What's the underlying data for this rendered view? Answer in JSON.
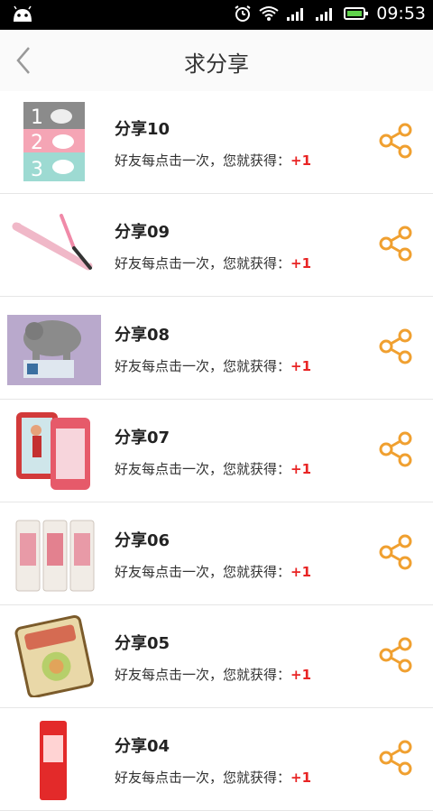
{
  "status_bar": {
    "time": "09:53"
  },
  "header": {
    "title": "求分享"
  },
  "items": [
    {
      "name": "分享10",
      "desc": "好友每点击一次，您就获得：",
      "reward": "+1"
    },
    {
      "name": "分享09",
      "desc": "好友每点击一次，您就获得：",
      "reward": "+1"
    },
    {
      "name": "分享08",
      "desc": "好友每点击一次，您就获得：",
      "reward": "+1"
    },
    {
      "name": "分享07",
      "desc": "好友每点击一次，您就获得：",
      "reward": "+1"
    },
    {
      "name": "分享06",
      "desc": "好友每点击一次，您就获得：",
      "reward": "+1"
    },
    {
      "name": "分享05",
      "desc": "好友每点击一次，您就获得：",
      "reward": "+1"
    },
    {
      "name": "分享04",
      "desc": "好友每点击一次，您就获得：",
      "reward": "+1"
    }
  ],
  "icons": {
    "share": "share-icon",
    "back": "back-chevron-icon"
  },
  "colors": {
    "accent": "#f0a030",
    "reward": "#e82424"
  }
}
